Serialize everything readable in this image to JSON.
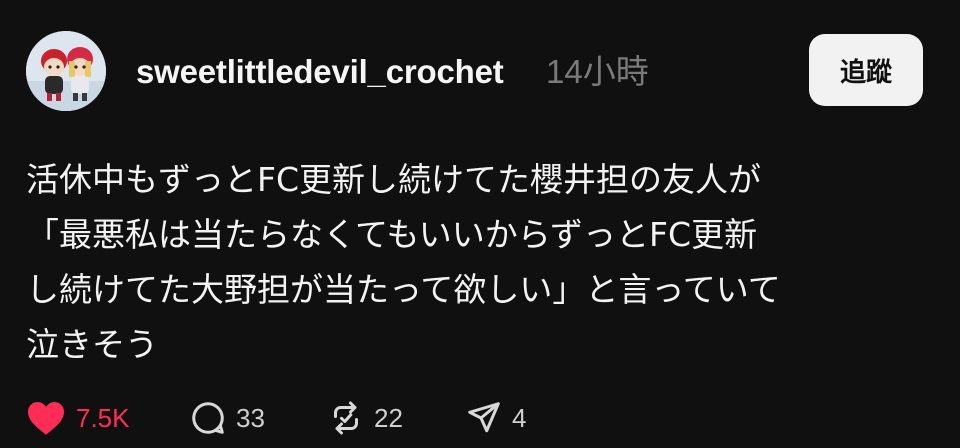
{
  "post": {
    "author": {
      "username": "sweetlittledevil_crochet",
      "avatar_icon": "avatar-crochet-dolls"
    },
    "timestamp": "14小時",
    "follow_label": "追蹤",
    "body_lines": [
      "活休中もずっとFC更新し続けてた櫻井担の友人が",
      "「最悪私は当たらなくてもいいからずっとFC更新",
      "し続けてた大野担が当たって欲しい」と言っていて",
      "泣きそう"
    ],
    "actions": {
      "like": {
        "icon": "heart-icon",
        "count": "7.5K",
        "liked": true,
        "color": "#ff2d55"
      },
      "reply": {
        "icon": "comment-icon",
        "count": "33"
      },
      "repost": {
        "icon": "repost-icon",
        "count": "22"
      },
      "share": {
        "icon": "share-icon",
        "count": "4"
      }
    }
  }
}
